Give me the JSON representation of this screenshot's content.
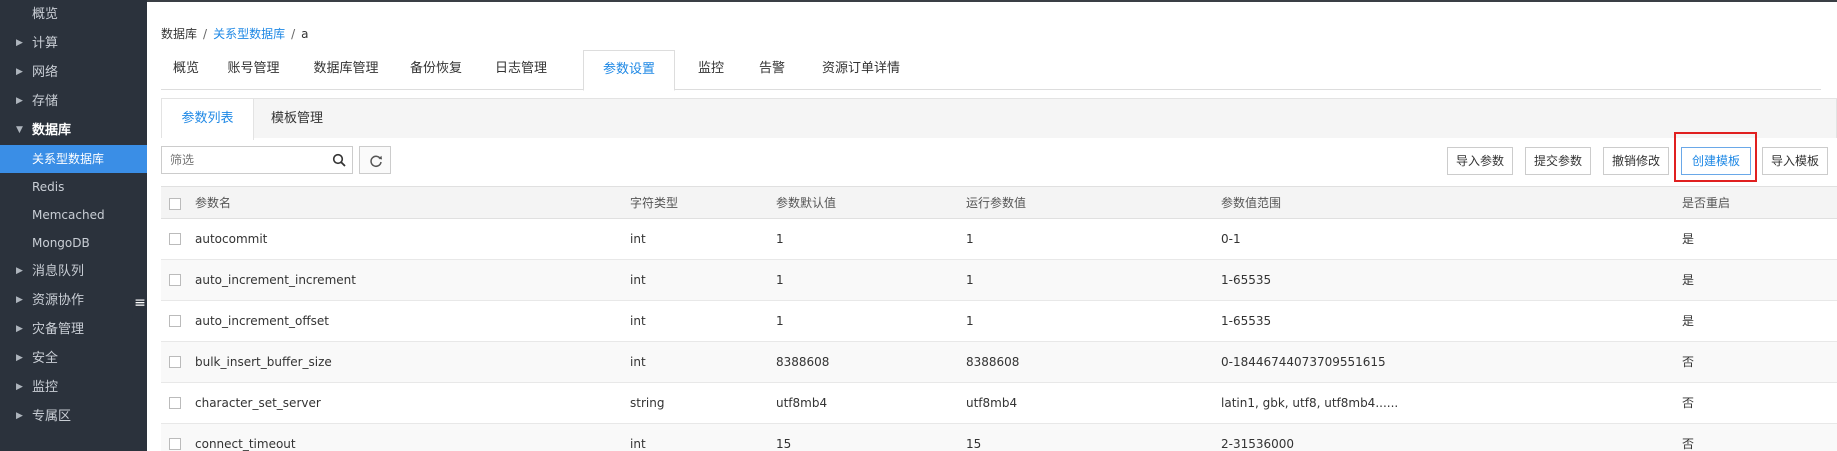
{
  "sidebar": {
    "items": [
      {
        "label": "概览",
        "type": "plain"
      },
      {
        "label": "计算",
        "type": "group"
      },
      {
        "label": "网络",
        "type": "group"
      },
      {
        "label": "存储",
        "type": "group"
      },
      {
        "label": "数据库",
        "type": "open"
      },
      {
        "label": "关系型数据库",
        "type": "active"
      },
      {
        "label": "Redis",
        "type": "sub"
      },
      {
        "label": "Memcached",
        "type": "sub"
      },
      {
        "label": "MongoDB",
        "type": "sub"
      },
      {
        "label": "消息队列",
        "type": "group"
      },
      {
        "label": "资源协作",
        "type": "group"
      },
      {
        "label": "灾备管理",
        "type": "group"
      },
      {
        "label": "安全",
        "type": "group"
      },
      {
        "label": "监控",
        "type": "group"
      },
      {
        "label": "专属区",
        "type": "group"
      }
    ],
    "collapse_icon": "≡"
  },
  "breadcrumb": {
    "root": "数据库",
    "middle": "关系型数据库",
    "current": "a",
    "separator": "/"
  },
  "tabs": [
    "概览",
    "账号管理",
    "数据库管理",
    "备份恢复",
    "日志管理",
    "参数设置",
    "监控",
    "告警",
    "资源订单详情"
  ],
  "active_tab": "参数设置",
  "subtabs": [
    "参数列表",
    "模板管理"
  ],
  "active_subtab": "参数列表",
  "toolbar": {
    "search_placeholder": "筛选",
    "buttons": [
      "导入参数",
      "提交参数",
      "撤销修改",
      "创建模板",
      "导入模板"
    ],
    "highlighted_button": "创建模板"
  },
  "table": {
    "columns": [
      "参数名",
      "字符类型",
      "参数默认值",
      "运行参数值",
      "参数值范围",
      "是否重启"
    ],
    "rows": [
      [
        "autocommit",
        "int",
        "1",
        "1",
        "0-1",
        "是"
      ],
      [
        "auto_increment_increment",
        "int",
        "1",
        "1",
        "1-65535",
        "是"
      ],
      [
        "auto_increment_offset",
        "int",
        "1",
        "1",
        "1-65535",
        "是"
      ],
      [
        "bulk_insert_buffer_size",
        "int",
        "8388608",
        "8388608",
        "0-18446744073709551615",
        "否"
      ],
      [
        "character_set_server",
        "string",
        "utf8mb4",
        "utf8mb4",
        "latin1, gbk, utf8, utf8mb4......",
        "否"
      ],
      [
        "connect_timeout",
        "int",
        "15",
        "15",
        "2-31536000",
        "否"
      ]
    ]
  },
  "colors": {
    "sidebar_bg": "#2b323c",
    "accent": "#1e88e5",
    "highlight": "#e02020"
  }
}
